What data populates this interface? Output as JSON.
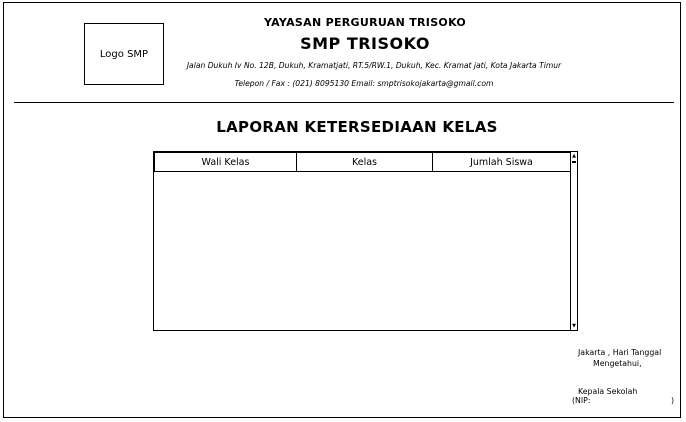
{
  "header": {
    "logo_placeholder": "Logo SMP",
    "foundation_name": "YAYASAN PERGURUAN TRISOKO",
    "school_name": "SMP TRISOKO",
    "address": "Jalan Dukuh Iv No. 12B, Dukuh, Kramatjati, RT.5/RW.1, Dukuh, Kec. Kramat jati, Kota Jakarta Timur",
    "contact": "Telepon / Fax : (021) 8095130 Email: smptrisokojakarta@gmail.com"
  },
  "report": {
    "title": "LAPORAN KETERSEDIAAN KELAS"
  },
  "table": {
    "columns": [
      "Wali Kelas",
      "Kelas",
      "Jumlah Siswa"
    ],
    "rows": []
  },
  "signature": {
    "place_date": "Jakarta , Hari Tanggal",
    "acknowledged": "Mengetahui,",
    "position": "Kepala Sekolah",
    "nip_label": "(NIP:",
    "nip_close": ")"
  }
}
